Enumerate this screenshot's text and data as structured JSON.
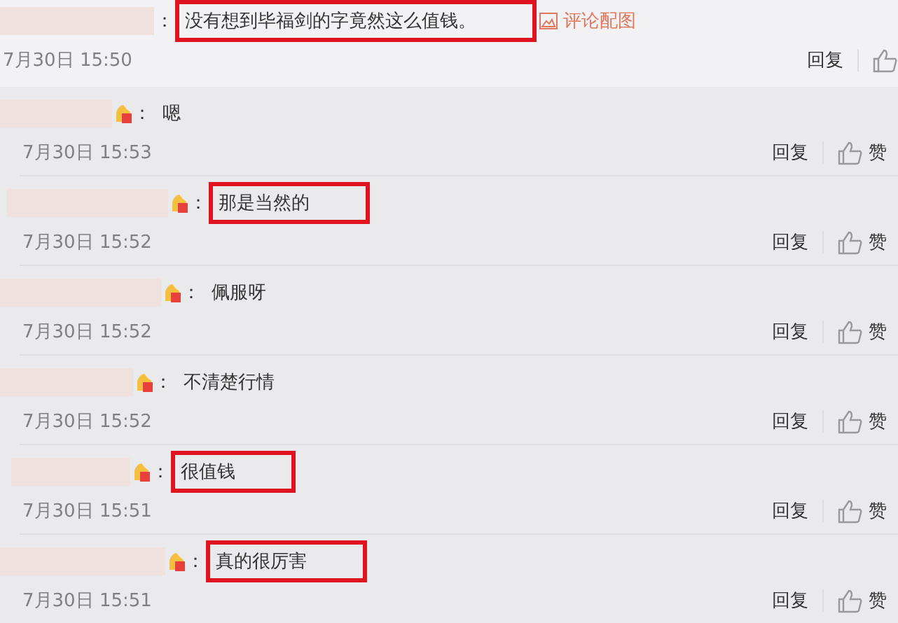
{
  "comment": {
    "separator": "：",
    "text": "没有想到毕福剑的字竟然这么值钱。",
    "highlighted": true,
    "image_link": "评论配图",
    "time": "7月30日 15:50",
    "reply": "回复"
  },
  "replies": [
    {
      "separator": "：",
      "text": "嗯",
      "highlighted": false,
      "time": "7月30日 15:53",
      "reply": "回复",
      "like": "赞"
    },
    {
      "separator": "：",
      "text": "那是当然的",
      "highlighted": true,
      "time": "7月30日 15:52",
      "reply": "回复",
      "like": "赞"
    },
    {
      "separator": "：",
      "text": "佩服呀",
      "highlighted": false,
      "time": "7月30日 15:52",
      "reply": "回复",
      "like": "赞"
    },
    {
      "separator": "：",
      "text": "不清楚行情",
      "highlighted": false,
      "time": "7月30日 15:52",
      "reply": "回复",
      "like": "赞"
    },
    {
      "separator": "：",
      "text": "很值钱",
      "highlighted": true,
      "time": "7月30日 15:51",
      "reply": "回复",
      "like": "赞"
    },
    {
      "separator": "：",
      "text": "真的很厉害",
      "highlighted": true,
      "time": "7月30日 15:51",
      "reply": "回复",
      "like": "赞"
    }
  ]
}
